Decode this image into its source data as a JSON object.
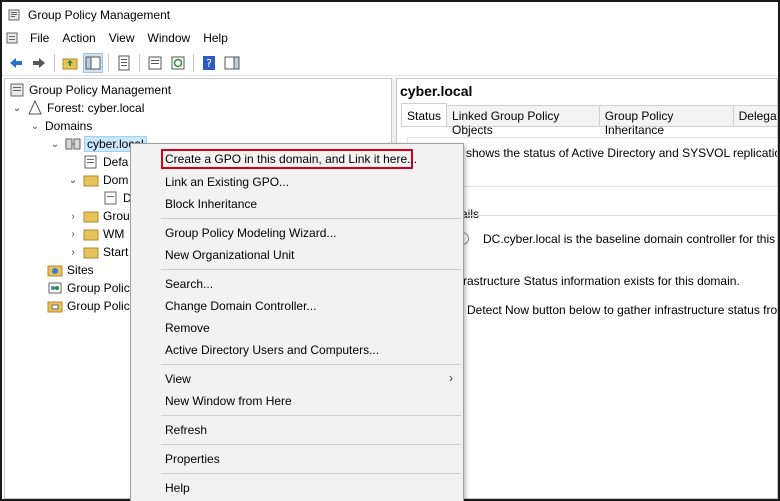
{
  "window": {
    "title": "Group Policy Management"
  },
  "menu": [
    "File",
    "Action",
    "View",
    "Window",
    "Help"
  ],
  "toolbar": {
    "icons": [
      "back-arrow-icon",
      "forward-arrow-icon",
      "up-folder-icon",
      "show-tree-icon",
      "properties-icon",
      "export-icon",
      "refresh-icon",
      "help-icon",
      "show-pane-icon"
    ]
  },
  "tree": {
    "root": "Group Policy Management",
    "forest": "Forest: cyber.local",
    "domains": "Domains",
    "domain": "cyber.local",
    "default_policy": "Defa",
    "domain_controllers": "Dom",
    "dc_child": "D",
    "gpo": "Grou",
    "wmi": "WM",
    "starter": "Start",
    "sites": "Sites",
    "modeling": "Group Polic",
    "results": "Group Polic"
  },
  "right": {
    "title": "cyber.local",
    "tabs": [
      "Status",
      "Linked Group Policy Objects",
      "Group Policy Inheritance",
      "Delegation"
    ],
    "status_line": "shows the status of Active Directory and SYSVOL replication for th",
    "details_label": "ails",
    "baseline_text": "DC.cyber.local is the baseline domain controller for this domain.",
    "infra_text": "rastructure Status information exists for this domain.",
    "detect_text": "Detect Now button below to gather infrastructure status from all of t"
  },
  "context_menu": {
    "items": [
      "Create a GPO in this domain, and Link it here...",
      "Link an Existing GPO...",
      "Block Inheritance",
      "Group Policy Modeling Wizard...",
      "New Organizational Unit",
      "Search...",
      "Change Domain Controller...",
      "Remove",
      "Active Directory Users and Computers...",
      "View",
      "New Window from Here",
      "Refresh",
      "Properties",
      "Help"
    ],
    "submenu_arrow": "›"
  },
  "colors": {
    "highlight_border": "#d0021b",
    "selection": "#cce8ff"
  }
}
